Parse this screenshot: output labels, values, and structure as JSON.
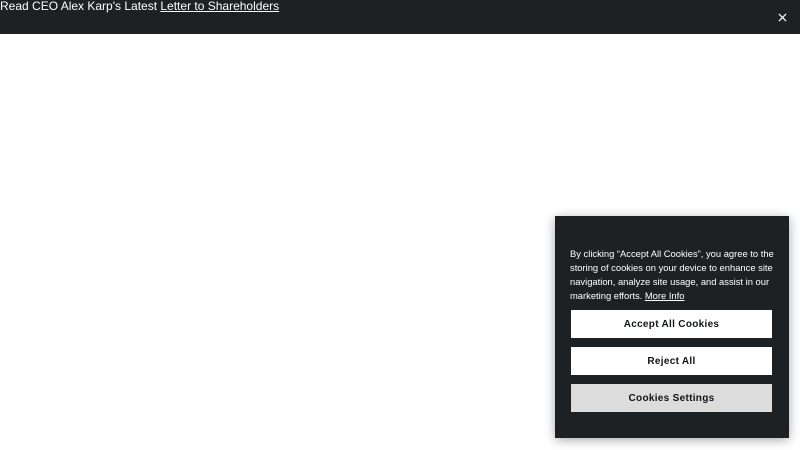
{
  "announcement": {
    "prefix": "Read CEO Alex Karp's Latest ",
    "link_text": "Letter to Shareholders",
    "close_icon": "close-icon"
  },
  "cookie_banner": {
    "text": "By clicking “Accept All Cookies”, you agree to the storing of cookies on your device to enhance site navigation, analyze site usage, and assist in our marketing efforts. ",
    "more_info": "More Info",
    "accept_label": "Accept All Cookies",
    "reject_label": "Reject All",
    "settings_label": "Cookies Settings"
  },
  "colors": {
    "dark_bar": "#1e2124",
    "button_light": "#ffffff",
    "button_gray": "#dcdcdc"
  }
}
